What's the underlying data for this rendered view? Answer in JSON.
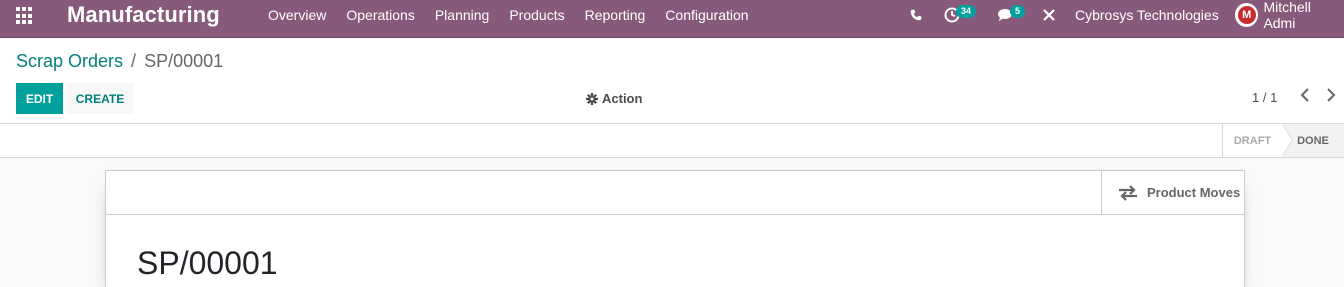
{
  "navbar": {
    "brand": "Manufacturing",
    "menu": [
      "Overview",
      "Operations",
      "Planning",
      "Products",
      "Reporting",
      "Configuration"
    ],
    "activities_count": "34",
    "messages_count": "5",
    "company": "Cybrosys Technologies",
    "user": "Mitchell Admi"
  },
  "breadcrumb": {
    "parent": "Scrap Orders",
    "separator": "/",
    "current": "SP/00001"
  },
  "buttons": {
    "edit": "EDIT",
    "create": "CREATE",
    "action": "Action"
  },
  "pager": {
    "value": "1 / 1"
  },
  "statusbar": {
    "stages": [
      "DRAFT",
      "DONE"
    ],
    "active": "DONE"
  },
  "sheet": {
    "stat_button": "Product Moves",
    "title": "SP/00001"
  },
  "colors": {
    "navbar": "#875a7b",
    "primary": "#00a09d",
    "link": "#00807c"
  },
  "icons": {
    "apps": "apps-grid-icon",
    "phone": "phone-icon",
    "activity": "clock-icon",
    "messages": "chat-icon",
    "debug": "close-icon",
    "action": "gear-icon",
    "prev": "chevron-left-icon",
    "next": "chevron-right-icon",
    "moves": "exchange-icon"
  }
}
